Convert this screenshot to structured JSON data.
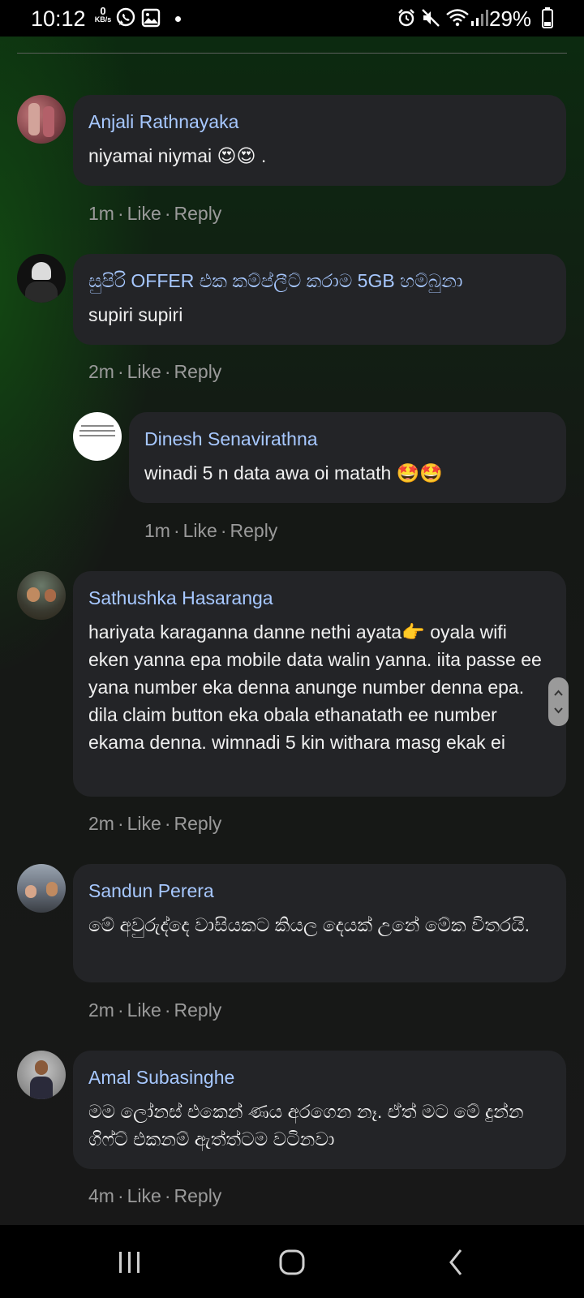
{
  "status_bar": {
    "time": "10:12",
    "net_speed_value": "0",
    "net_speed_unit": "KB/s",
    "battery_text": "29%",
    "icons": [
      "whatsapp-icon",
      "gallery-icon",
      "alarm-icon",
      "mute-icon",
      "wifi-icon",
      "signal-icon",
      "battery-icon"
    ]
  },
  "comments": [
    {
      "author": "Anjali Rathnayaka",
      "text": "niyamai niymai 😍😍 .",
      "time": "1m",
      "like": "Like",
      "reply": "Reply"
    },
    {
      "author": "සුපිරි OFFER එක කම්ප්ලීට් කරාම 5GB හම්බුනා",
      "text": "supiri supiri",
      "time": "2m",
      "like": "Like",
      "reply": "Reply"
    },
    {
      "author": "Dinesh Senavirathna",
      "text": "winadi 5 n data awa oi matath 🤩🤩",
      "time": "1m",
      "like": "Like",
      "reply": "Reply"
    },
    {
      "author": "Sathushka Hasaranga",
      "text": "hariyata karaganna danne nethi ayata👉 oyala wifi eken yanna epa mobile data walin yanna. iita passe ee yana number eka denna anunge number denna epa. dila claim button eka obala ethanatath ee number ekama denna. wimnadi 5 kin withara masg ekak ei",
      "time": "2m",
      "like": "Like",
      "reply": "Reply"
    },
    {
      "author": "Sandun Perera",
      "text": "මේ අවුරුද්දෙ වාසියකට කියල දෙයක් උනේ මේක විතරයි.",
      "time": "2m",
      "like": "Like",
      "reply": "Reply"
    },
    {
      "author": "Amal Subasinghe",
      "text": "මම ලෝනස් එකෙන් ණය අරගෙන නෑ. ඒත් මට මේ දුන්න ගිෆ්ට් එකනම් ඇත්ත්ටම වටිනවා",
      "time": "4m",
      "like": "Like",
      "reply": "Reply"
    }
  ],
  "separator": "·",
  "nav": {
    "icons": [
      "recent-apps-icon",
      "home-icon",
      "back-icon"
    ]
  }
}
